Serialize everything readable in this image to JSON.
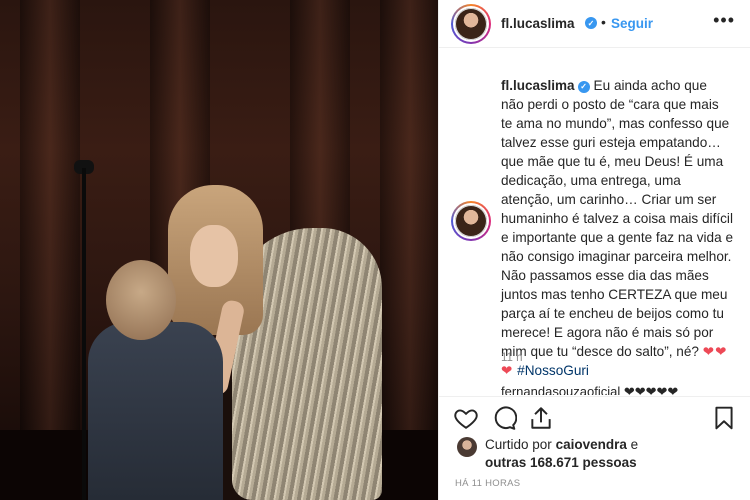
{
  "post": {
    "username": "fl.lucaslima",
    "follow_label": "Seguir",
    "dot": "•",
    "more_icon": "•••"
  },
  "caption": {
    "username": "fl.lucaslima",
    "text": "Eu ainda acho que não perdi o posto de “cara que mais te ama no mundo”, mas confesso que talvez esse guri esteja empatando… que mãe que tu é, meu Deus! É uma dedicação, uma entrega, uma atenção, um carinho… Criar um ser humaninho é talvez a coisa mais difícil e importante que a gente faz na vida e não consigo imaginar parceira melhor. Não passamos esse dia das mães juntos mas tenho CERTEZA que meu parça aí te encheu de beijos como tu merece! E agora não é mais só por mim que tu “desce do salto”, né?",
    "hearts": "❤❤❤",
    "hashtag": "#NossoGuri",
    "time": "11 h",
    "next_comment_preview": "fernandasouzaoficial ❤❤❤❤❤"
  },
  "actions": {
    "like_icon": "heart-outline-icon",
    "comment_icon": "comment-icon",
    "share_icon": "share-icon",
    "save_icon": "bookmark-icon"
  },
  "likes": {
    "prefix": "Curtido por",
    "user": "caiovendra",
    "conj": "e",
    "others": "outras 168.671 pessoas"
  },
  "timestamp": "HÁ 11 HORAS",
  "colors": {
    "link_blue": "#3897f0",
    "hashtag": "#003569",
    "heart_red": "#ed4956",
    "muted": "#8e8e8e"
  }
}
